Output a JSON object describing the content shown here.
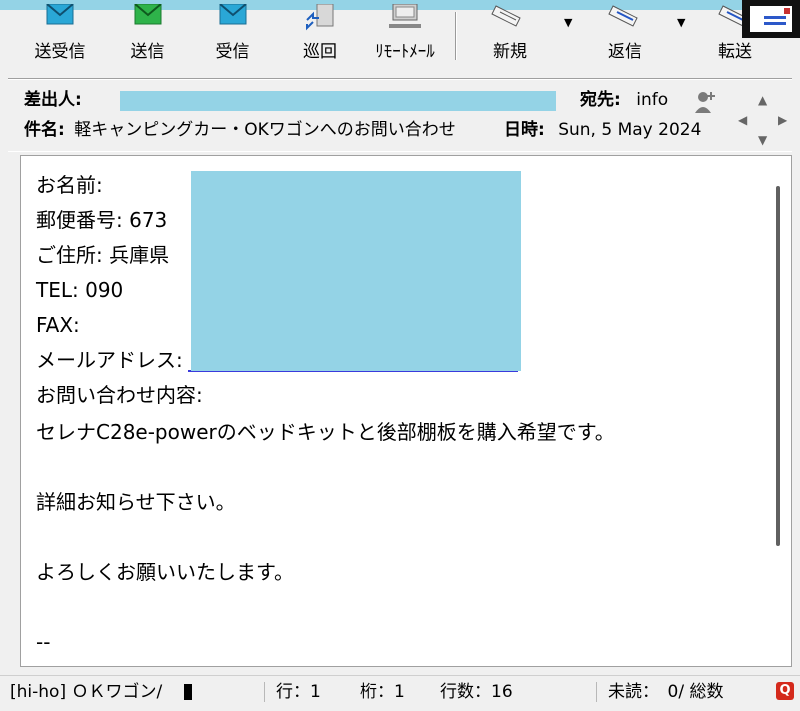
{
  "toolbar": {
    "buttons": [
      {
        "label": "送受信",
        "icon": "send-receive-icon"
      },
      {
        "label": "送信",
        "icon": "send-icon"
      },
      {
        "label": "受信",
        "icon": "receive-icon"
      },
      {
        "label": "巡回",
        "icon": "patrol-icon"
      },
      {
        "label": "ﾘﾓｰﾄﾒｰﾙ",
        "icon": "remote-mail-icon"
      },
      {
        "label": "新規",
        "icon": "new-mail-icon"
      },
      {
        "label": "返信",
        "icon": "reply-icon"
      },
      {
        "label": "転送",
        "icon": "forward-icon"
      }
    ],
    "dropdown_glyph": "▼"
  },
  "header": {
    "from_label": "差出人:",
    "to_label": "宛先:",
    "to_value": "info",
    "subject_label": "件名:",
    "subject_value": "軽キャンピングカー・OKワゴンへのお問い合わせ",
    "date_label": "日時:",
    "date_value": "Sun, 5 May 2024"
  },
  "body": {
    "lines": [
      "お名前:",
      "郵便番号: 673",
      "ご住所: 兵庫県",
      "TEL:         090",
      "FAX:",
      "メールアドレス: ",
      "お問い合わせ内容:",
      "セレナC28e-powerのベッドキットと後部棚板を購入希望です。",
      "",
      "詳細お知らせ下さい。",
      "",
      "よろしくお願いいたします。",
      "",
      "--"
    ]
  },
  "status": {
    "folder": "[hi-ho] ＯＫワゴン/",
    "row": "行：1",
    "col": "桁：1",
    "lines": "行数：16",
    "unread": "未読：　0/ 総数",
    "q_glyph": "Q"
  },
  "colors": {
    "redaction": "#94d3e6",
    "link": "#3a3adc",
    "q_icon": "#d42a1c"
  }
}
